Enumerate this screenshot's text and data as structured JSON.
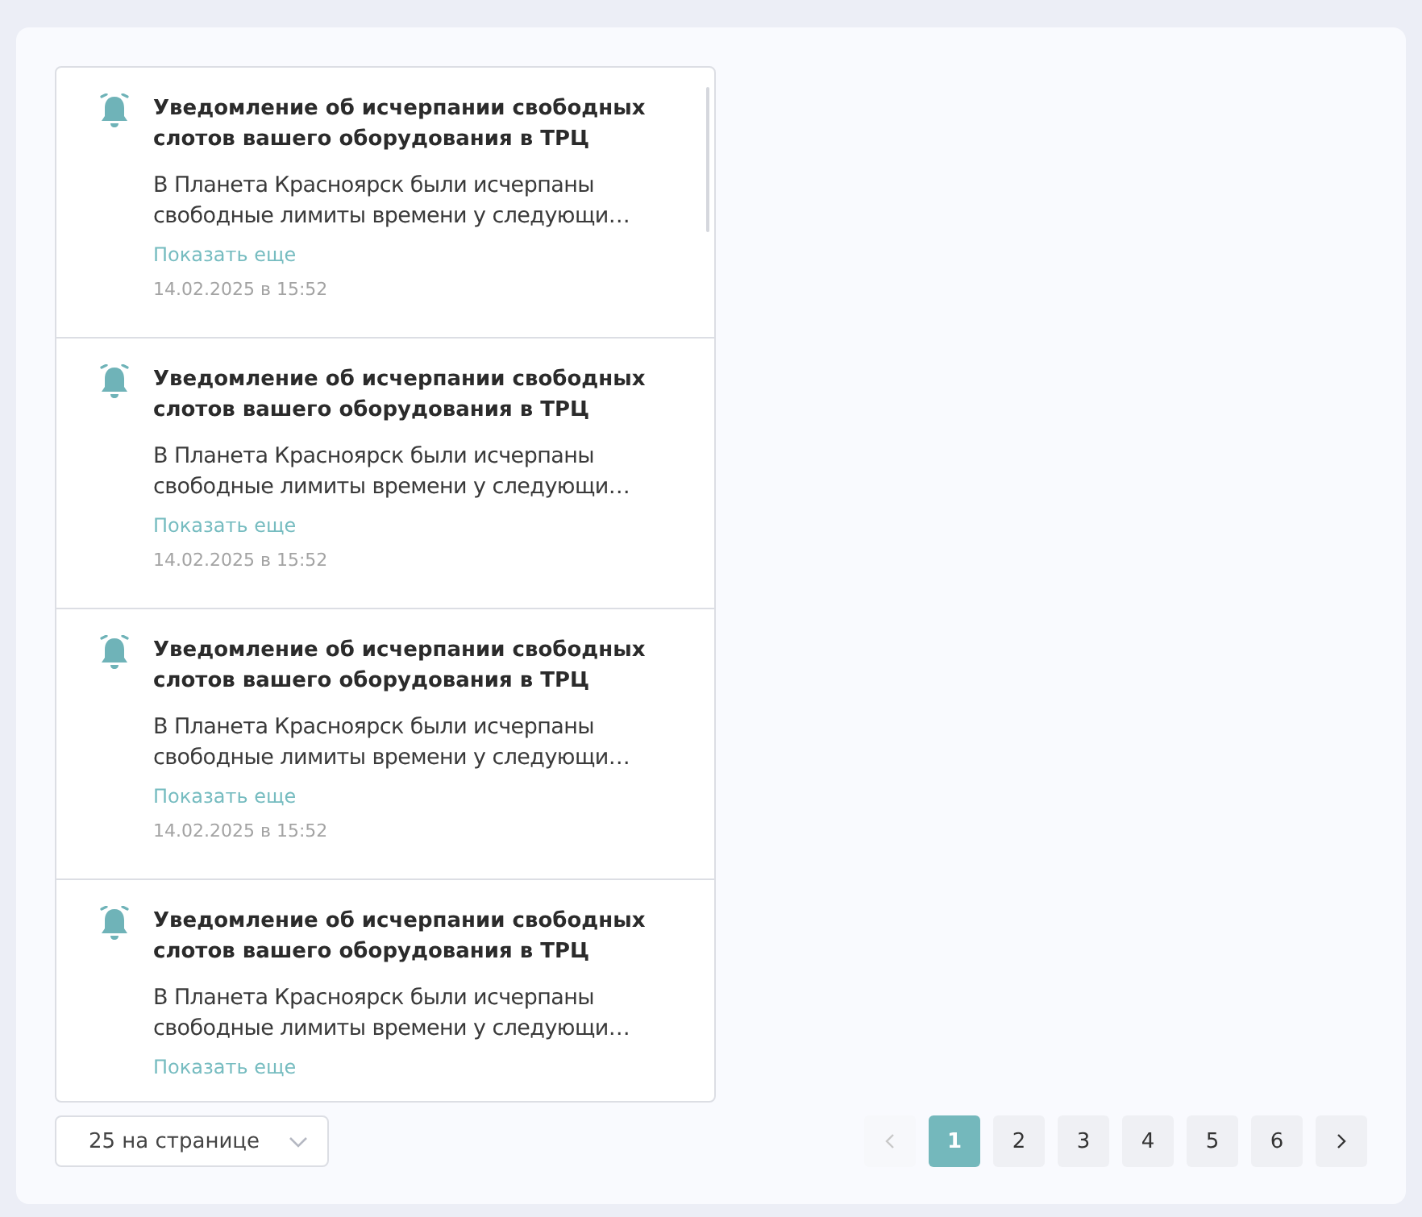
{
  "notifications": [
    {
      "title": "Уведомление об исчерпании свободных слотов вашего оборудования в ТРЦ",
      "text": "В Планета Красноярск были исчерпаны\nсвободные лимиты времени у следующи…",
      "link": "Показать еще",
      "date": "14.02.2025 в 15:52"
    },
    {
      "title": "Уведомление об исчерпании свободных слотов вашего оборудования в ТРЦ",
      "text": "В Планета Красноярск были исчерпаны\nсвободные лимиты времени у следующи…",
      "link": "Показать еще",
      "date": "14.02.2025 в 15:52"
    },
    {
      "title": "Уведомление об исчерпании свободных слотов вашего оборудования в ТРЦ",
      "text": "В Планета Красноярск были исчерпаны\nсвободные лимиты времени у следующи…",
      "link": "Показать еще",
      "date": "14.02.2025 в 15:52"
    },
    {
      "title": "Уведомление об исчерпании свободных слотов вашего оборудования в ТРЦ",
      "text": "В Планета Красноярск были исчерпаны\nсвободные лимиты времени у следующи…",
      "link": "Показать еще"
    }
  ],
  "page_size": "25 на странице",
  "pagination": {
    "prev_disabled": true,
    "next_disabled": false,
    "pages": [
      {
        "label": "1",
        "selected": true
      },
      {
        "label": "2",
        "selected": false
      },
      {
        "label": "3",
        "selected": false
      },
      {
        "label": "4",
        "selected": false
      },
      {
        "label": "5",
        "selected": false
      },
      {
        "label": "6",
        "selected": false
      }
    ]
  }
}
